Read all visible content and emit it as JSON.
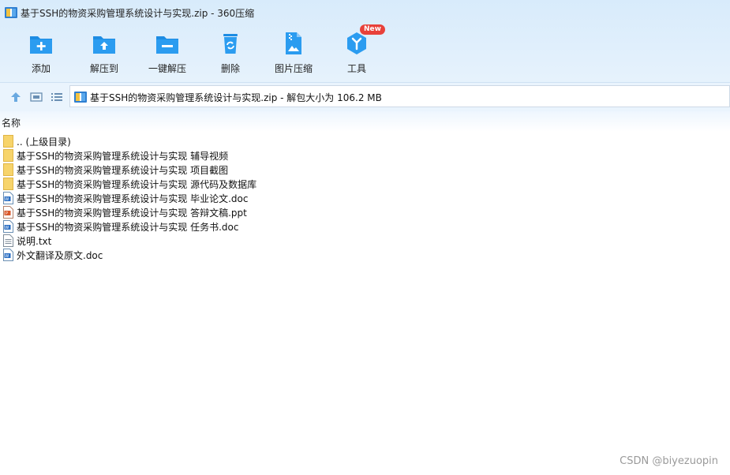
{
  "window": {
    "title": "基于SSH的物资采购管理系统设计与实现.zip - 360压缩"
  },
  "toolbar": {
    "items": [
      {
        "label": "添加",
        "icon": "add-folder-icon"
      },
      {
        "label": "解压到",
        "icon": "extract-to-icon"
      },
      {
        "label": "一键解压",
        "icon": "one-click-extract-icon"
      },
      {
        "label": "删除",
        "icon": "recycle-delete-icon"
      },
      {
        "label": "图片压缩",
        "icon": "image-compress-icon"
      },
      {
        "label": "工具",
        "icon": "tools-icon",
        "badge": "New"
      }
    ]
  },
  "addressbar": {
    "path": "基于SSH的物资采购管理系统设计与实现.zip - 解包大小为 106.2 MB"
  },
  "list": {
    "column_name": "名称",
    "rows": [
      {
        "name": ".. (上级目录)",
        "type": "folder"
      },
      {
        "name": "基于SSH的物资采购管理系统设计与实现 辅导视频",
        "type": "folder"
      },
      {
        "name": "基于SSH的物资采购管理系统设计与实现 项目截图",
        "type": "folder"
      },
      {
        "name": "基于SSH的物资采购管理系统设计与实现 源代码及数据库",
        "type": "folder"
      },
      {
        "name": "基于SSH的物资采购管理系统设计与实现 毕业论文.doc",
        "type": "doc"
      },
      {
        "name": "基于SSH的物资采购管理系统设计与实现 答辩文稿.ppt",
        "type": "ppt"
      },
      {
        "name": "基于SSH的物资采购管理系统设计与实现 任务书.doc",
        "type": "doc"
      },
      {
        "name": "说明.txt",
        "type": "txt"
      },
      {
        "name": "外文翻译及原文.doc",
        "type": "doc"
      }
    ]
  },
  "watermark": "CSDN @biyezuopin",
  "colors": {
    "accent": "#1a8fe0",
    "folder": "#f7d46b",
    "badge": "#e8413a"
  }
}
